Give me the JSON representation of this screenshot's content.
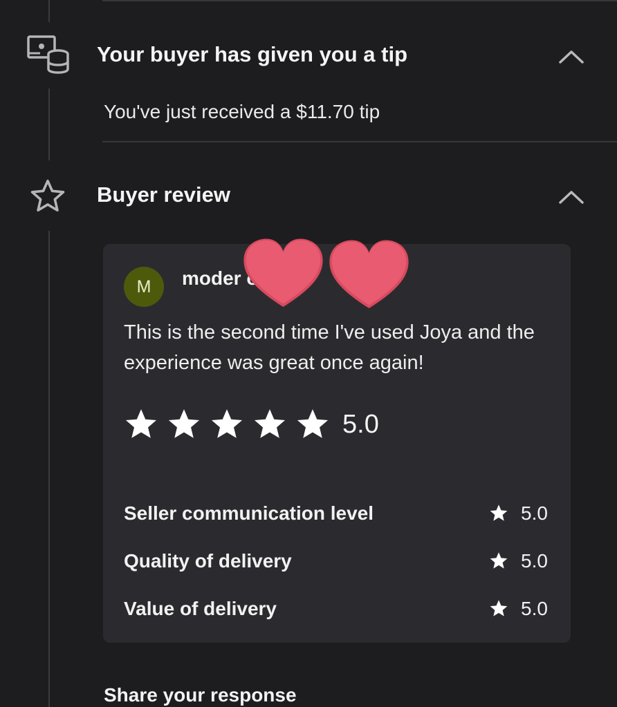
{
  "tip_section": {
    "title": "Your buyer has given you a tip",
    "message": "You've just received a $11.70 tip",
    "icon": "tip-money-icon",
    "collapse_icon": "chevron-up-icon"
  },
  "review_section": {
    "title": "Buyer review",
    "icon": "star-outline-icon",
    "collapse_icon": "chevron-up-icon",
    "reviewer": {
      "avatar_initial": "M",
      "name_visible": "moder        o",
      "avatar_color": "#4d5a0c"
    },
    "review_text": "This is the second time I've used Joya and the experience was great once again!",
    "overall_rating": "5.0",
    "overall_stars": 5,
    "sub_ratings": [
      {
        "label": "Seller communication level",
        "value": "5.0"
      },
      {
        "label": "Quality of delivery",
        "value": "5.0"
      },
      {
        "label": "Value of delivery",
        "value": "5.0"
      }
    ]
  },
  "share_response_label": "Share your response",
  "colors": {
    "background": "#1d1d1f",
    "card": "#2b2b2f",
    "heart_sticker": "#e65a6e",
    "text": "#f2f2f2"
  }
}
